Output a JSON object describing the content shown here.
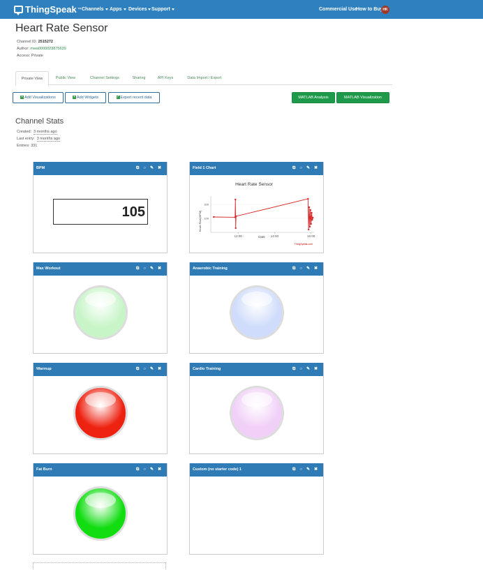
{
  "app": {
    "logo_text": "ThingSpeak",
    "logo_tm": "™",
    "nav": {
      "channels": "Channels",
      "apps": "Apps",
      "devices": "Devices",
      "support": "Support",
      "commercial": "Commercial Use",
      "howtobuy": "How to Buy",
      "avatar": "HK"
    },
    "colors": {
      "brand": "#2f80bf",
      "widget_header": "#2f7bb5",
      "green_button": "#1e9a4a",
      "line": "#d62728"
    }
  },
  "channel": {
    "title": "Heart Rate Sensor",
    "id_label": "Channel ID:",
    "id_value": "2515272",
    "author_label": "Author:",
    "author_value": "mwa0000023875639",
    "access_label": "Access:",
    "access_value": "Private"
  },
  "tabs": [
    {
      "label": "Private View"
    },
    {
      "label": "Public View"
    },
    {
      "label": "Channel Settings"
    },
    {
      "label": "Sharing"
    },
    {
      "label": "API Keys"
    },
    {
      "label": "Data Import / Export"
    }
  ],
  "buttons": {
    "add_visualizations": "Add Visualizations",
    "add_widgets": "Add Widgets",
    "export": "Export recent data",
    "matlab_analysis": "MATLAB Analysis",
    "matlab_visualization": "MATLAB Visualization"
  },
  "stats": {
    "title": "Channel Stats",
    "created_label": "Created:",
    "created_value": "3 months ago",
    "last_entry_label": "Last entry:",
    "last_entry_value": "3 months ago",
    "entries_label": "Entries:",
    "entries_value": "331"
  },
  "widgets": {
    "bpm": {
      "title": "BPM",
      "value": "105"
    },
    "field1": {
      "title": "Field 1 Chart"
    },
    "max_workout": {
      "title": "Max Workout",
      "lamp_color": "#c8f5c8"
    },
    "anaerobic": {
      "title": "Anaerobic Training",
      "lamp_color": "#cfdcfb"
    },
    "warmup": {
      "title": "Warmup",
      "lamp_color": "#ee2211"
    },
    "cardio": {
      "title": "Cardio Training",
      "lamp_color": "#f1d0f7"
    },
    "fat_burn": {
      "title": "Fat Burn",
      "lamp_color": "#11dd11"
    },
    "custom": {
      "title": "Custom (no starter code) 1"
    }
  },
  "chart_data": {
    "type": "line",
    "title": "Heart Rate Sensor",
    "xlabel": "Date",
    "ylabel": "Heart Rate(BPM)",
    "x_ticks": [
      "12:00",
      "14:00",
      "16:00"
    ],
    "y_ticks": [
      100,
      200
    ],
    "credit": "ThingSpeak.com",
    "series": [
      {
        "x": [
          "10:40",
          "11:50",
          "11:51",
          "11:52",
          "11:53",
          "15:50",
          "15:52",
          "15:54",
          "15:56",
          "15:58",
          "16:00",
          "16:02",
          "16:04",
          "16:06"
        ],
        "y": [
          110,
          108,
          235,
          30,
          115,
          240,
          20,
          180,
          40,
          160,
          60,
          140,
          90,
          105
        ]
      }
    ]
  }
}
